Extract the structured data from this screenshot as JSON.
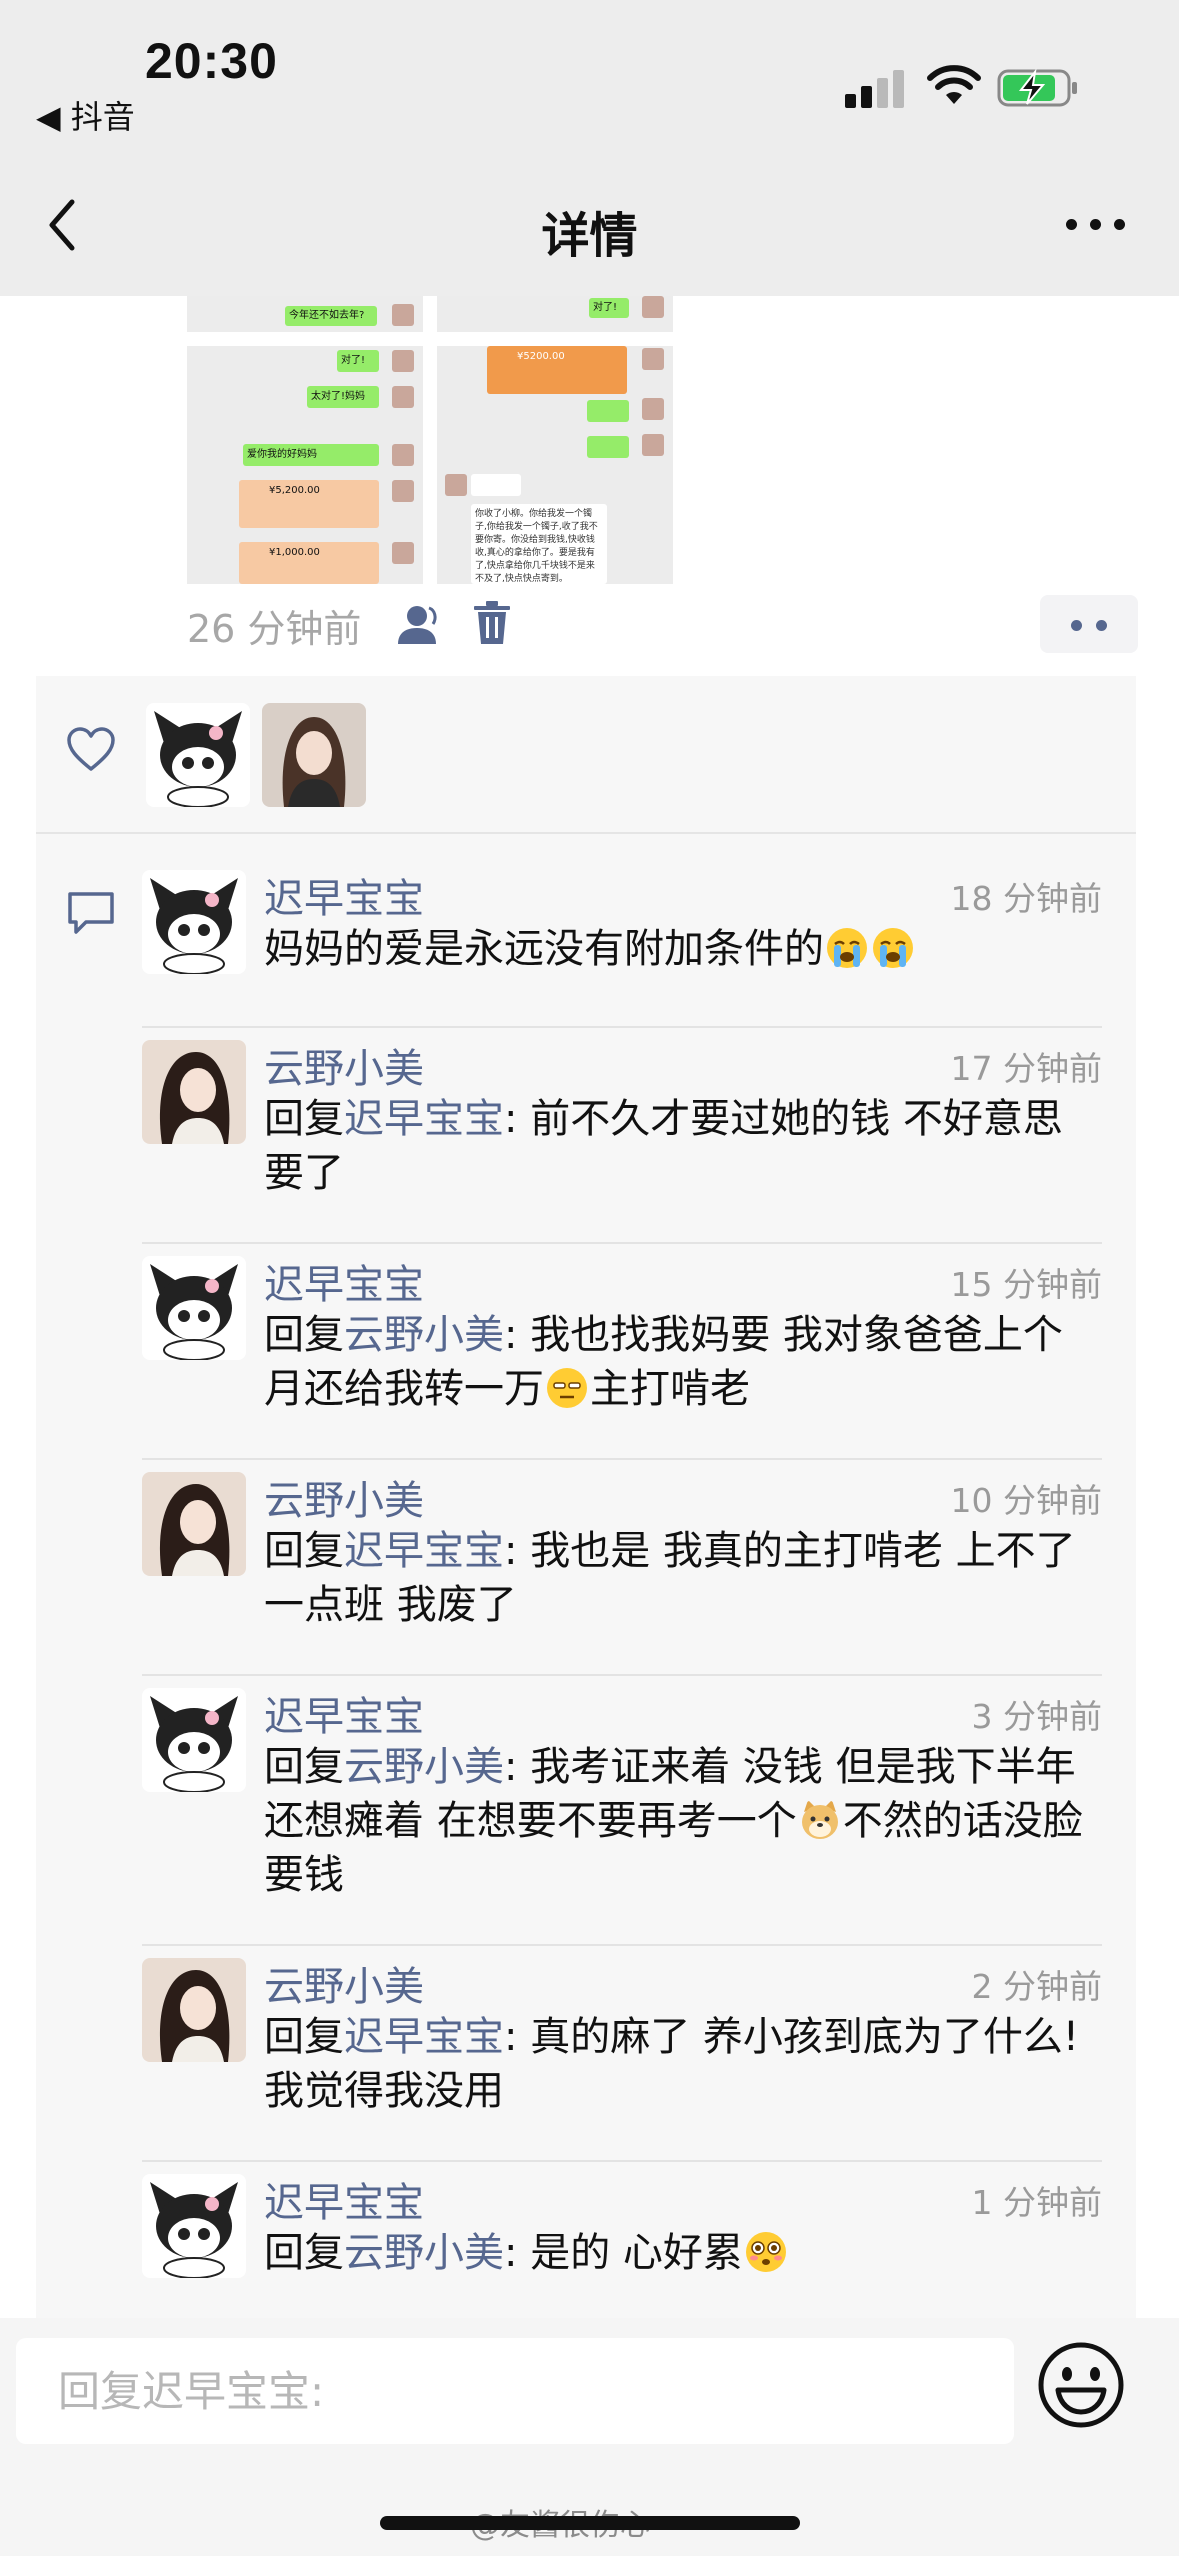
{
  "status_bar": {
    "time": "20:30",
    "back_app": "◀ 抖音"
  },
  "nav": {
    "title": "详情"
  },
  "post": {
    "time_ago": "26 分钟前",
    "grid_texts": {
      "left_top_1": "今年还不如去年?",
      "left_1": "对了!",
      "left_2": "太对了!妈妈",
      "left_3": "爱你我的好妈妈",
      "left_4": "¥5,200.00",
      "left_5": "¥1,000.00",
      "right_top": "对了!",
      "right_1": "¥5200.00",
      "right_2": "你收了小柳。你给我发一个镯子,你给我发一个镯子,收了我不要你寄。你没给到我钱,快收钱收,真心的拿给你了。要是我有了,快点拿给你几千块钱不是来不及了,快点快点寄到。"
    }
  },
  "likes": {
    "users": [
      "迟早宝宝",
      "云野小美"
    ]
  },
  "comments": [
    {
      "author": "迟早宝宝",
      "time": "18 分钟前",
      "reply_prefix": "",
      "reply_to": "",
      "text": "妈妈的爱是永远没有附加条件的",
      "emoji": [
        "crying-face",
        "crying-face"
      ]
    },
    {
      "author": "云野小美",
      "time": "17 分钟前",
      "reply_prefix": "回复",
      "reply_to": "迟早宝宝",
      "text": ": 前不久才要过她的钱 不好意思要了",
      "emoji": []
    },
    {
      "author": "迟早宝宝",
      "time": "15 分钟前",
      "reply_prefix": "回复",
      "reply_to": "云野小美",
      "text": ": 我也找我妈要 我对象爸爸上个月还给我转一万",
      "text_after": "主打啃老",
      "emoji": [
        "unamused-face"
      ]
    },
    {
      "author": "云野小美",
      "time": "10 分钟前",
      "reply_prefix": "回复",
      "reply_to": "迟早宝宝",
      "text": ": 我也是 我真的主打啃老 上不了一点班 我废了",
      "emoji": []
    },
    {
      "author": "迟早宝宝",
      "time": "3 分钟前",
      "reply_prefix": "回复",
      "reply_to": "云野小美",
      "text": ": 我考证来着  没钱 但是我下半年还想瘫着  在想要不要再考一个",
      "text_after": "不然的话没脸要钱",
      "emoji": [
        "doge-face"
      ]
    },
    {
      "author": "云野小美",
      "time": "2 分钟前",
      "reply_prefix": "回复",
      "reply_to": "迟早宝宝",
      "text": ": 真的麻了 养小孩到底为了什么! 我觉得我没用",
      "emoji": []
    },
    {
      "author": "迟早宝宝",
      "time": "1 分钟前",
      "reply_prefix": "回复",
      "reply_to": "云野小美",
      "text": ": 是的 心好累",
      "emoji": [
        "flushed-face"
      ]
    }
  ],
  "input": {
    "placeholder": "回复迟早宝宝:"
  },
  "watermark": "@友酱很伤心",
  "colors": {
    "name_blue": "#56678f",
    "topbar_bg": "#ededed",
    "panel_bg": "#f7f7f7",
    "wechat_green": "#95ec69",
    "battery_green": "#34c759"
  }
}
